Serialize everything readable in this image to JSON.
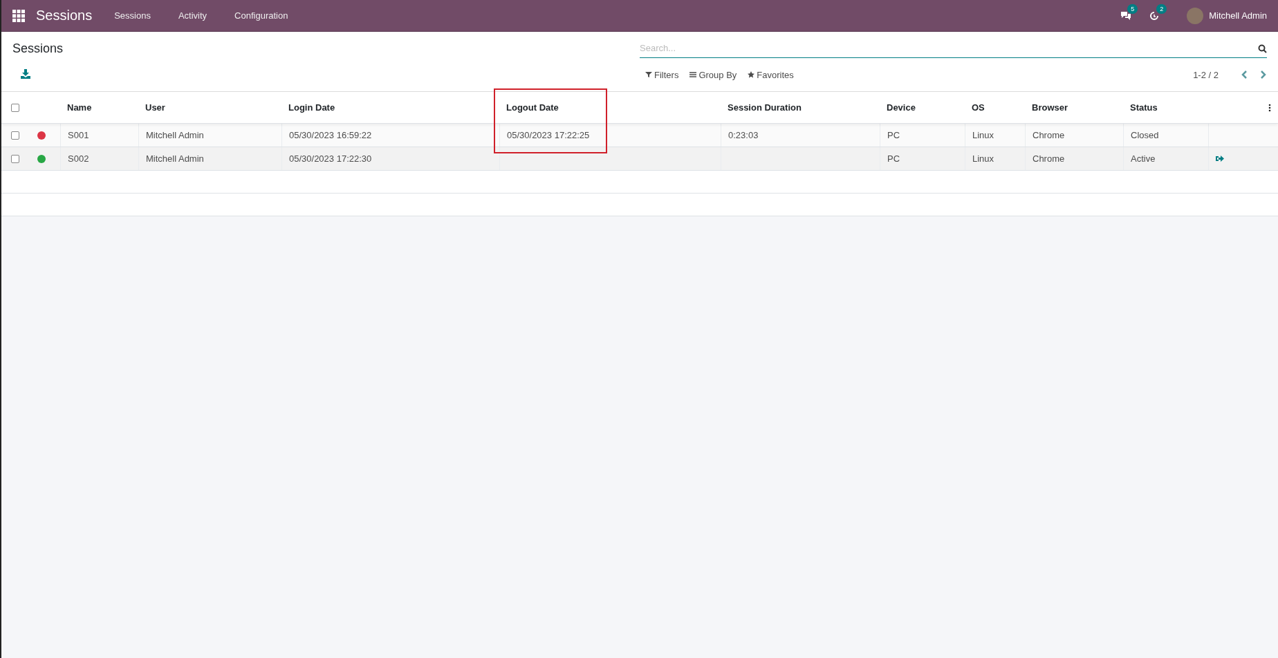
{
  "navbar": {
    "app_title": "Sessions",
    "menu": [
      {
        "label": "Sessions"
      },
      {
        "label": "Activity"
      },
      {
        "label": "Configuration"
      }
    ],
    "messages_count": "5",
    "activities_count": "2",
    "user_name": "Mitchell Admin"
  },
  "control_panel": {
    "title": "Sessions",
    "search": {
      "placeholder": "Search..."
    },
    "filters": [
      {
        "kind": "filter",
        "label": "Filters"
      },
      {
        "kind": "group",
        "label": "Group By"
      },
      {
        "kind": "favorite",
        "label": "Favorites"
      }
    ],
    "pager": "1-2 / 2"
  },
  "table": {
    "select_all": false,
    "columns": [
      {
        "label": "Name",
        "highlighted": false
      },
      {
        "label": "User",
        "highlighted": false
      },
      {
        "label": "Login Date",
        "highlighted": false
      },
      {
        "label": "Logout Date",
        "highlighted": true
      },
      {
        "label": "Session Duration",
        "highlighted": false
      },
      {
        "label": "Device",
        "highlighted": false
      },
      {
        "label": "OS",
        "highlighted": false
      },
      {
        "label": "Browser",
        "highlighted": false
      },
      {
        "label": "Status",
        "highlighted": false
      }
    ],
    "rows": [
      {
        "checked": false,
        "color": "#dc3545",
        "cells": [
          "S001",
          "Mitchell Admin",
          "05/30/2023 16:59:22",
          "05/30/2023 17:22:25",
          "0:23:03",
          "PC",
          "Linux",
          "Chrome",
          "Closed"
        ],
        "logout_action": false
      },
      {
        "checked": false,
        "color": "#28a745",
        "cells": [
          "S002",
          "Mitchell Admin",
          "05/30/2023 17:22:30",
          "",
          "",
          "PC",
          "Linux",
          "Chrome",
          "Active"
        ],
        "logout_action": true
      }
    ]
  }
}
